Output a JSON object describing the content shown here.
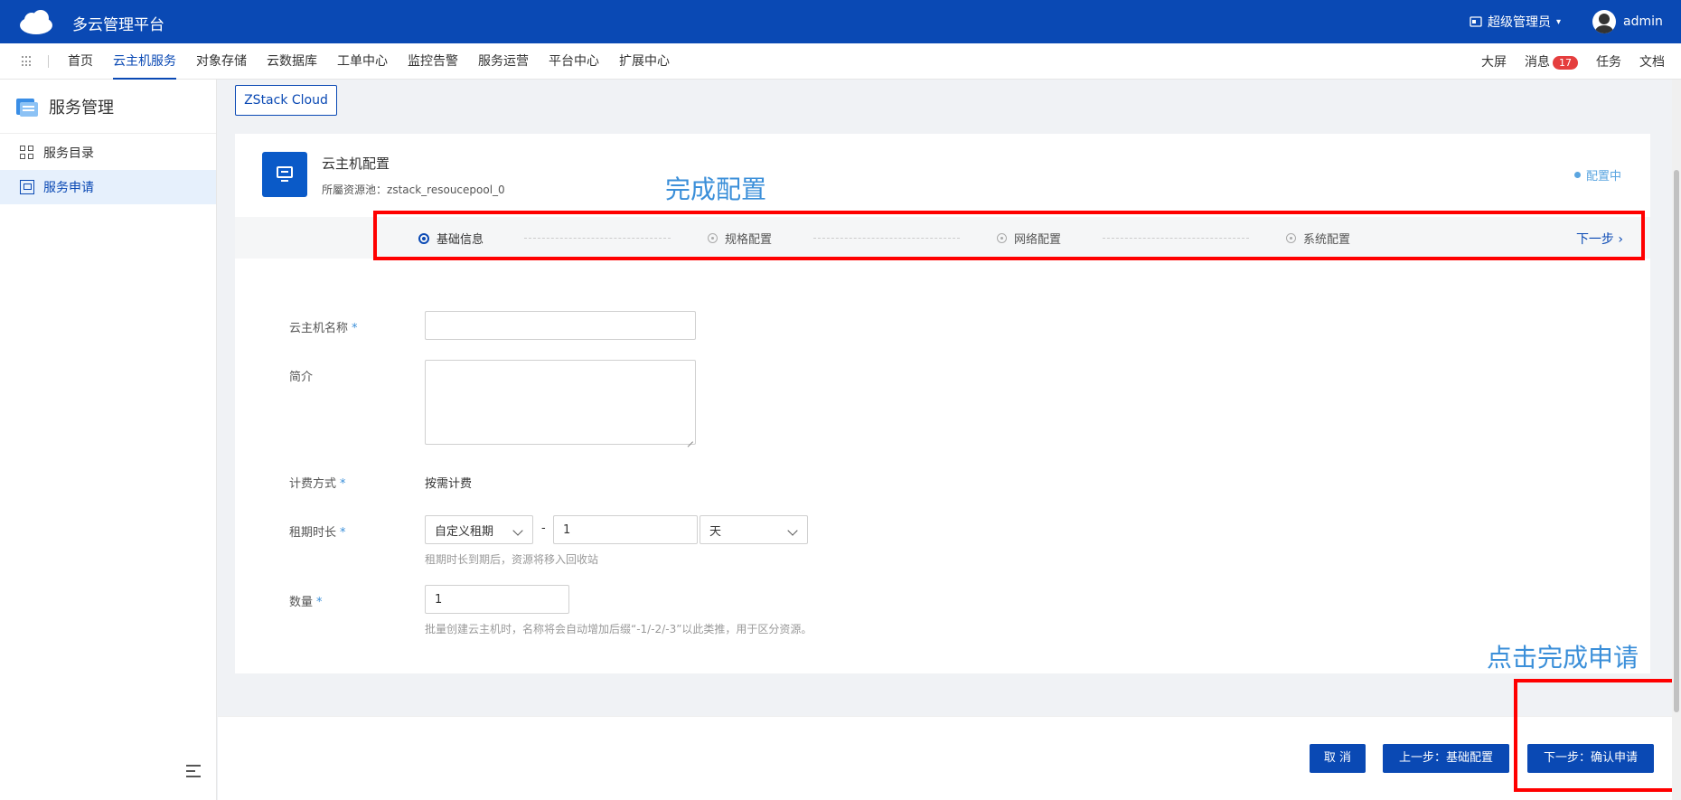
{
  "app": {
    "title": "多云管理平台",
    "role": "超级管理员",
    "user": "admin"
  },
  "nav": {
    "items": [
      {
        "label": "首页",
        "active": false
      },
      {
        "label": "云主机服务",
        "active": true
      },
      {
        "label": "对象存储",
        "active": false
      },
      {
        "label": "云数据库",
        "active": false
      },
      {
        "label": "工单中心",
        "active": false
      },
      {
        "label": "监控告警",
        "active": false
      },
      {
        "label": "服务运营",
        "active": false
      },
      {
        "label": "平台中心",
        "active": false
      },
      {
        "label": "扩展中心",
        "active": false
      }
    ],
    "right": {
      "screen": "大屏",
      "messages": "消息",
      "message_count": "17",
      "tasks": "任务",
      "docs": "文档"
    }
  },
  "sidebar": {
    "title": "服务管理",
    "items": [
      {
        "label": "服务目录",
        "active": false
      },
      {
        "label": "服务申请",
        "active": true
      }
    ]
  },
  "cloud_tab": "ZStack Cloud",
  "card": {
    "title": "云主机配置",
    "pool_label": "所屬资源池：",
    "pool_value": "zstack_resoucepool_0",
    "status": "配置中"
  },
  "steps": {
    "items": [
      "基础信息",
      "规格配置",
      "网络配置",
      "系统配置"
    ],
    "active_index": 0,
    "next": "下一步"
  },
  "annotations": {
    "top": "完成配置",
    "bottom": "点击完成申请"
  },
  "form": {
    "name_label": "云主机名称",
    "name_value": "",
    "desc_label": "简介",
    "desc_value": "",
    "billing_label": "计费方式",
    "billing_value": "按需计费",
    "lease_label": "租期时长",
    "lease_type": "自定义租期",
    "lease_sep": "-",
    "lease_value": "1",
    "lease_unit": "天",
    "lease_hint": "租期时长到期后，资源将移入回收站",
    "qty_label": "数量",
    "qty_value": "1",
    "qty_hint": "批量创建云主机时，名称将会自动增加后缀“-1/-2/-3”以此类推，用于区分资源。",
    "required_mark": "*"
  },
  "footer": {
    "cancel": "取 消",
    "prev": "上一步：基础配置",
    "next": "下一步：确认申请"
  }
}
